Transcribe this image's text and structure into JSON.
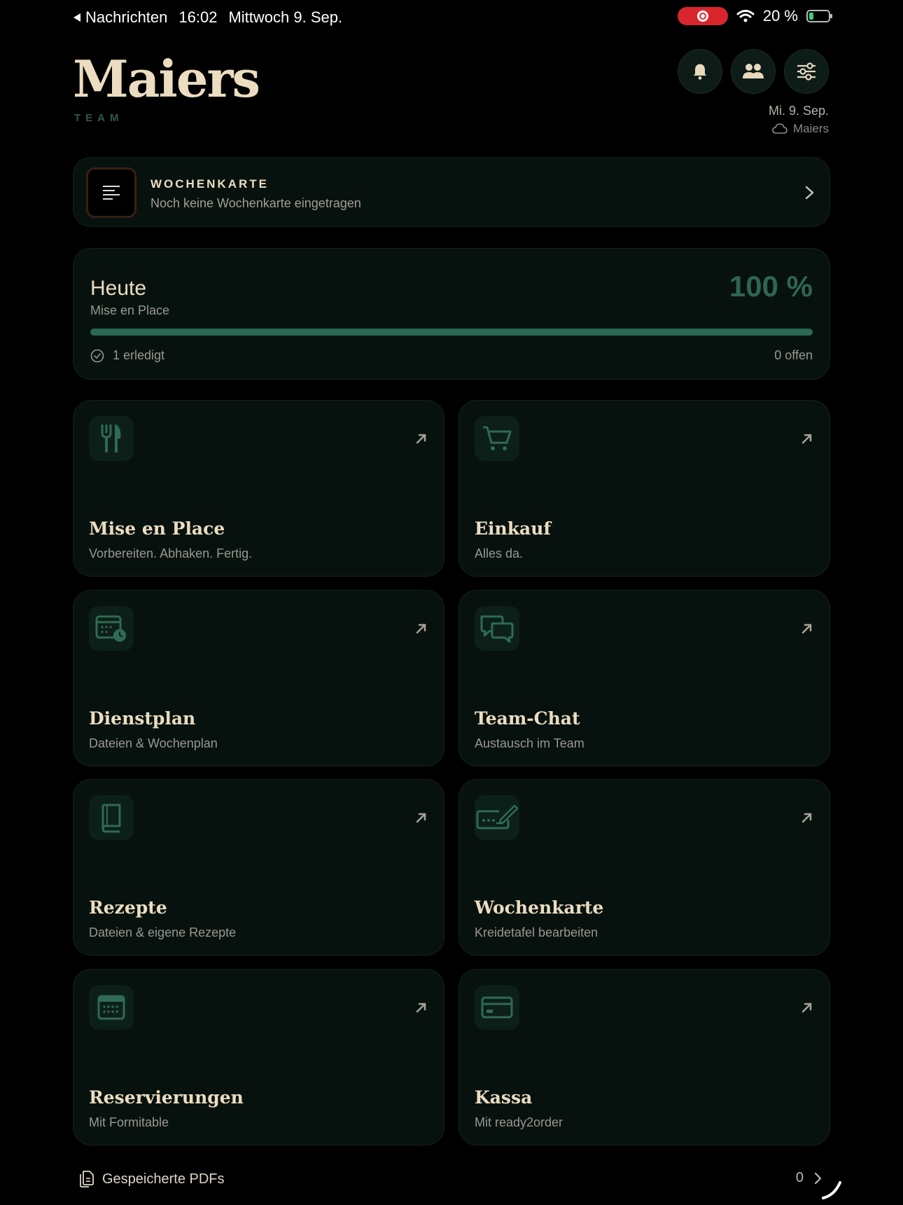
{
  "status_bar": {
    "back_app": "Nachrichten",
    "time": "16:02",
    "date": "Mittwoch 9. Sep.",
    "battery": "20 %"
  },
  "header": {
    "brand": "Maiers",
    "brand_sub": "TEAM",
    "date": "Mi. 9. Sep.",
    "sync_label": "Maiers"
  },
  "banner": {
    "title": "WOCHENKARTE",
    "subtitle": "Noch keine Wochenkarte eingetragen"
  },
  "today": {
    "title": "Heute",
    "subtitle": "Mise en Place",
    "percent_label": "100 %",
    "progress": 1.0,
    "done": "1 erledigt",
    "open": "0 offen"
  },
  "tiles": [
    {
      "title": "Mise en Place",
      "subtitle": "Vorbereiten. Abhaken. Fertig.",
      "icon": "fork-knife-icon"
    },
    {
      "title": "Einkauf",
      "subtitle": "Alles da.",
      "icon": "cart-icon"
    },
    {
      "title": "Dienstplan",
      "subtitle": "Dateien & Wochenplan",
      "icon": "calendar-clock-icon"
    },
    {
      "title": "Team-Chat",
      "subtitle": "Austausch im Team",
      "icon": "chat-bubbles-icon"
    },
    {
      "title": "Rezepte",
      "subtitle": "Dateien & eigene Rezepte",
      "icon": "book-icon"
    },
    {
      "title": "Wochenkarte",
      "subtitle": "Kreidetafel bearbeiten",
      "icon": "signature-icon"
    },
    {
      "title": "Reservierungen",
      "subtitle": "Mit Formitable",
      "icon": "calendar-icon"
    },
    {
      "title": "Kassa",
      "subtitle": "Mit ready2order",
      "icon": "credit-card-icon"
    }
  ],
  "pdfs": {
    "label": "Gespeicherte PDFs",
    "count": "0"
  },
  "colors": {
    "background": "#000000",
    "card": "#07120f",
    "accent_green": "#2a6a52",
    "cream": "#ecdcc0",
    "record_red": "#d9262c"
  }
}
